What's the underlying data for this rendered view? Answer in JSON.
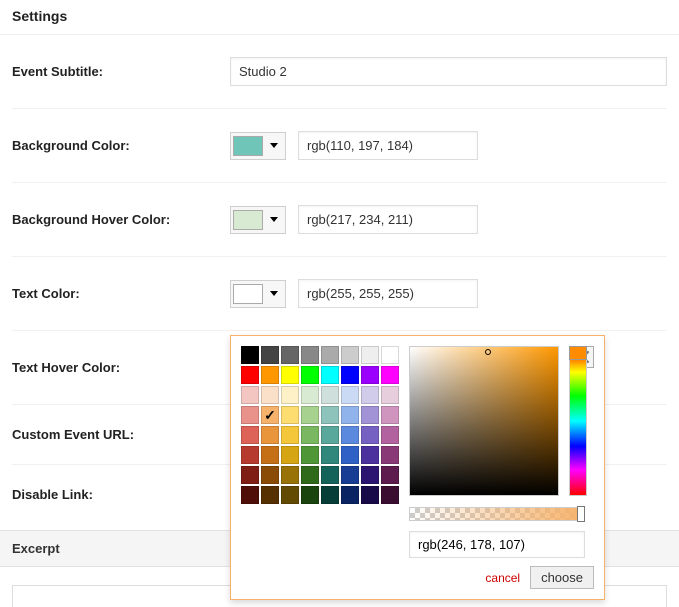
{
  "section_title": "Settings",
  "fields": {
    "subtitle": {
      "label": "Event Subtitle:",
      "value": "Studio 2"
    },
    "bg": {
      "label": "Background Color:",
      "swatch": "#6ec5b8",
      "value": "rgb(110, 197, 184)"
    },
    "bg_hover": {
      "label": "Background Hover Color:",
      "swatch": "#d9ead3",
      "value": "rgb(217, 234, 211)"
    },
    "text": {
      "label": "Text Color:",
      "swatch": "#ffffff",
      "value": "rgb(255, 255, 255)"
    },
    "text_hover": {
      "label": "Text Hover Color:",
      "swatch": "#f6b26b",
      "value": "rgb(246, 178, 107)"
    },
    "url": {
      "label": "Custom Event URL:"
    },
    "disable": {
      "label": "Disable Link:"
    }
  },
  "excerpt_title": "Excerpt",
  "picker": {
    "value": "rgb(246, 178, 107)",
    "cancel": "cancel",
    "choose": "choose",
    "selected_index": 25,
    "palette": [
      "#000000",
      "#444444",
      "#666666",
      "#888888",
      "#aaaaaa",
      "#cccccc",
      "#eeeeee",
      "#ffffff",
      "#ff0000",
      "#ff9800",
      "#ffff00",
      "#00ff00",
      "#00ffff",
      "#0000ff",
      "#9b00ff",
      "#ff00ff",
      "#f3c6c2",
      "#fbe0c9",
      "#fef1c8",
      "#d8ead1",
      "#cedfdc",
      "#cadaf5",
      "#d0ccea",
      "#e6cedc",
      "#e9928b",
      "#f6b26b",
      "#fedd70",
      "#a6d18f",
      "#8dc3bb",
      "#8fb3ea",
      "#a193d5",
      "#cf95be",
      "#dd6258",
      "#e8953c",
      "#f4c63a",
      "#79b860",
      "#5aa79c",
      "#5b89dd",
      "#7561c2",
      "#b2639f",
      "#b73a2e",
      "#c57017",
      "#d6a513",
      "#4f9637",
      "#2f887b",
      "#2f60c5",
      "#4a319e",
      "#8a3977",
      "#7e1e15",
      "#8a4b07",
      "#987207",
      "#2f6a1b",
      "#14635a",
      "#183b94",
      "#2b1570",
      "#5d1b4e",
      "#4f0f08",
      "#563000",
      "#624a02",
      "#19440e",
      "#063e37",
      "#0a2363",
      "#180a48",
      "#3b0e31"
    ]
  }
}
